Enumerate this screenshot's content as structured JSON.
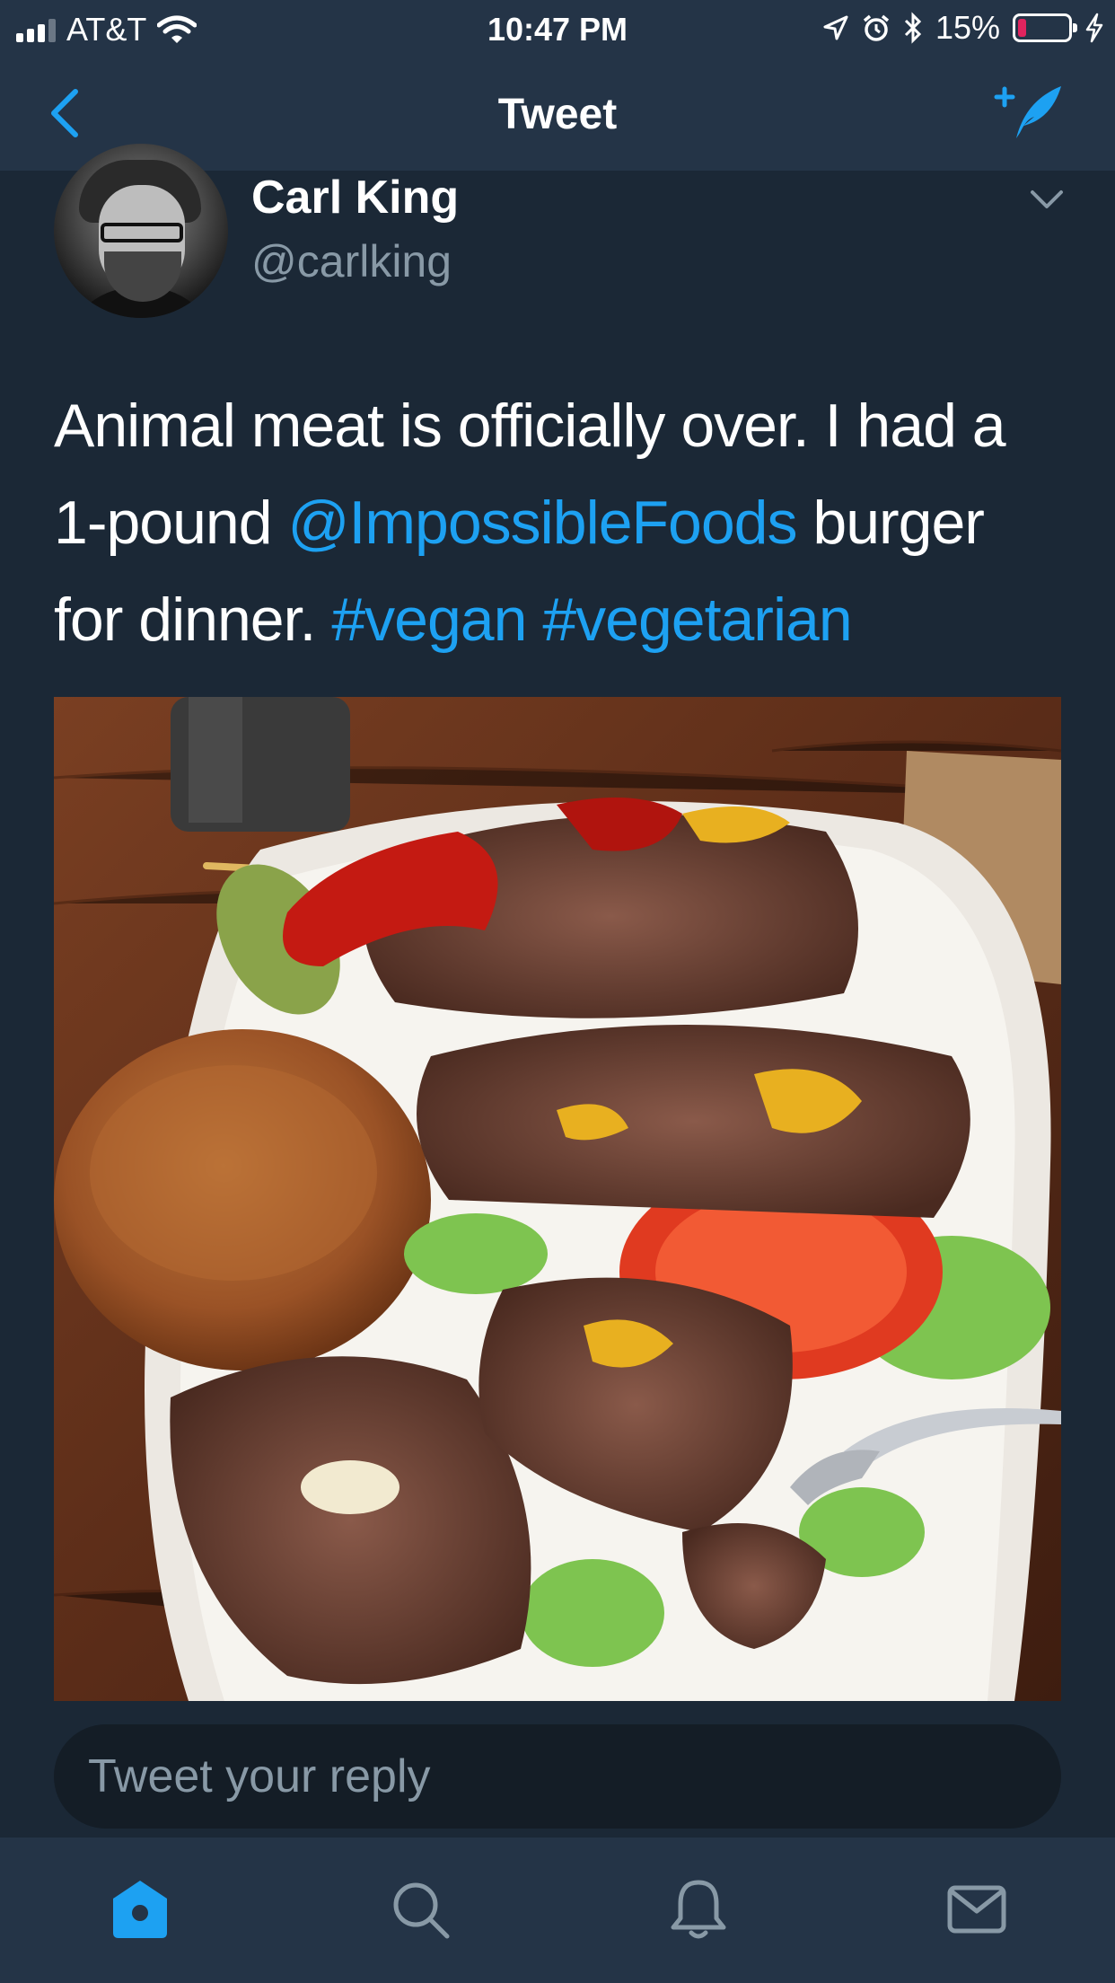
{
  "status_bar": {
    "carrier": "AT&T",
    "time": "10:47 PM",
    "battery_percent": "15%"
  },
  "nav": {
    "title": "Tweet"
  },
  "tweet": {
    "author_name": "Carl King",
    "author_handle": "@carlking",
    "text_part1": "Animal meat is officially over. I had a 1-pound ",
    "mention": "@ImpossibleFoods",
    "text_part2": " burger for dinner. ",
    "hashtag1": "#vegan",
    "hashtag2": "#vegetarian"
  },
  "reply": {
    "placeholder": "Tweet your reply"
  },
  "tabs": {
    "icons": [
      "home-icon",
      "search-icon",
      "notifications-icon",
      "messages-icon"
    ],
    "active": "home-icon"
  },
  "colors": {
    "accent": "#1da1f2",
    "background": "#1b2836",
    "bar": "#243447",
    "secondary_text": "#8899a6",
    "battery_low": "#e0245e"
  }
}
